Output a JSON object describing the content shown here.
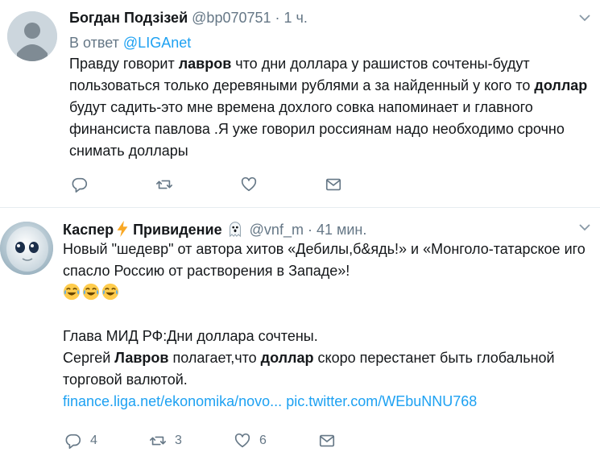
{
  "tweet1": {
    "name": "Богдан Подзізей",
    "handle": "@bp070751",
    "time": "· 1 ч.",
    "reply_prefix": "В ответ",
    "reply_to": "@LIGAnet",
    "text": [
      {
        "t": "Правду говорит "
      },
      {
        "t": "лавров",
        "b": true
      },
      {
        "t": " что дни доллара у рашистов сочтены-будут пользоваться только деревяными рублями а за найденный у кого то "
      },
      {
        "t": "доллар",
        "b": true
      },
      {
        "t": " будут садить-это мне времена дохлого совка напоминает и главного финансиста павлова .Я уже говорил россиянам надо необходимо срочно снимать доллары"
      }
    ],
    "actions": {
      "reply": "",
      "retweet": "",
      "like": ""
    }
  },
  "tweet2": {
    "name_part1": "Каспер",
    "name_part2": "Привидение",
    "handle": "@vnf_m",
    "time": "· 41 мин.",
    "line1": "Новый \"шедевр\" от автора хитов «Дебилы,б&ядь!» и «Монголо-татарское иго",
    "line2": "спасло Россию от растворения в Западе»!",
    "line4": "Глава МИД РФ:Дни доллара сочтены.",
    "line5_a": "Сергей ",
    "line5_b": "Лавров",
    "line5_c": " полагает,что ",
    "line5_d": "доллар",
    "line5_e": " скоро перестанет быть глобальной",
    "line6": "торговой валютой.",
    "link1": "finance.liga.net/ekonomika/novo...",
    "link2": "pic.twitter.com/WEbuNNU768",
    "actions": {
      "reply": "4",
      "retweet": "3",
      "like": "6"
    }
  },
  "colors": {
    "accent": "#1da1f2",
    "muted": "#657786",
    "text": "#14171a"
  },
  "icons": [
    "caret-down-icon",
    "reply-icon",
    "retweet-icon",
    "like-icon",
    "dm-icon",
    "lightning-emoji",
    "ghost-emoji",
    "joy-emoji"
  ]
}
